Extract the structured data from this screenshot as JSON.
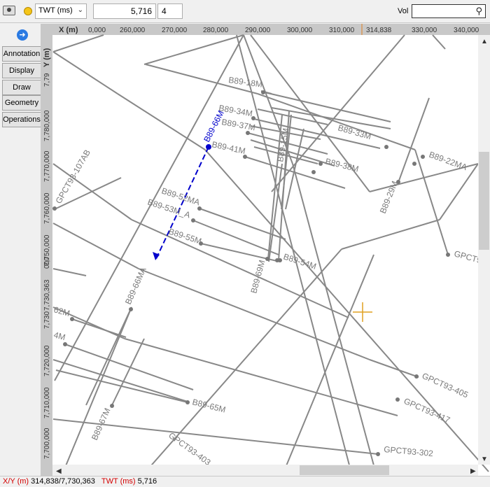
{
  "toolbar": {
    "domain_select": "TWT (ms)",
    "value": "5,716",
    "step": "4",
    "vol_label": "Vol",
    "vol_value": ""
  },
  "sidebar": {
    "tabs": [
      "Annotation",
      "Display",
      "Draw",
      "Geometry",
      "Operations"
    ]
  },
  "map": {
    "x_axis_label": "X (m)",
    "y_axis_label": "Y (m)",
    "x_ticks": [
      "0,000",
      "260,000",
      "270,000",
      "280,000",
      "290,000",
      "300,000",
      "310,000",
      "314,838",
      "330,000",
      "340,000"
    ],
    "y_ticks": [
      "7,79",
      "7,780,000",
      "7,770,000",
      "7,760,000",
      "7,750,000",
      "000",
      "7,730,363",
      "7,730",
      "7,720,000",
      "7,710,000",
      "7,700,000"
    ],
    "line_labels": [
      "B89-18M",
      "B89-34M",
      "B89-37M",
      "B89-33M",
      "B89-66M",
      "B89-41M",
      "B89-15M",
      "B89-22MA",
      "B89-38M",
      "GPCT93-107AB",
      "B89-29M",
      "B89-52MA",
      "B89-53M_A",
      "B89-55M",
      "B89-54M",
      "GPCT9",
      "B89-69M",
      "B89-66MA",
      "62M",
      "4M",
      "GPCT93-405",
      "GPCT93-417",
      "B89-65M",
      "B89-67M",
      "GPCT93-403",
      "GPCT93-302"
    ]
  },
  "status": {
    "xy_label": "X/Y (m)",
    "xy_value": "314,838/7,730,363",
    "twt_label": "TWT (ms)",
    "twt_value": "5,716"
  },
  "colors": {
    "seismic_line": "#888888",
    "selected_line": "#0000cc",
    "cursor": "#e0a020",
    "status_label": "#d40000"
  }
}
